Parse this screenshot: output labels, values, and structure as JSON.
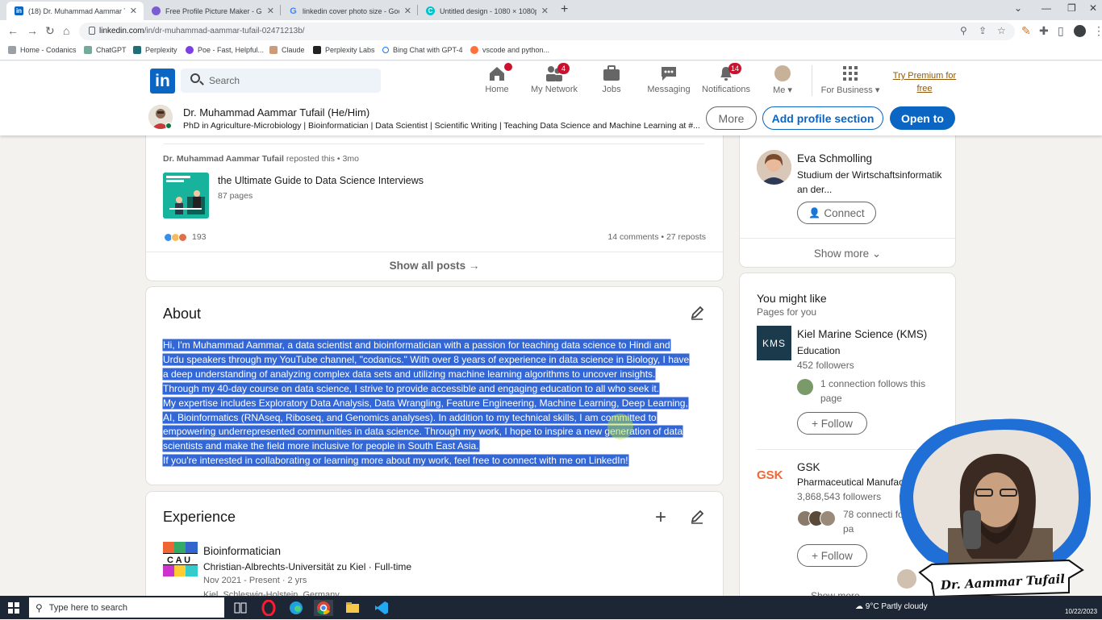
{
  "browser": {
    "tabs": [
      {
        "title": "(18) Dr. Muhammad Aammar Tu",
        "favicon": "linkedin-icon",
        "active": true
      },
      {
        "title": "Free Profile Picture Maker - Gen",
        "favicon": "profile-maker-icon"
      },
      {
        "title": "linkedin cover photo size - Goog",
        "favicon": "google-icon"
      },
      {
        "title": "Untitled design - 1080 × 1080px",
        "favicon": "canva-icon"
      }
    ],
    "url_host": "linkedin.com",
    "url_path": "/in/dr-muhammad-aammar-tufail-02471213b/",
    "bookmarks": [
      "Home - Codanics",
      "ChatGPT",
      "Perplexity",
      "Poe - Fast, Helpful...",
      "Claude",
      "Perplexity Labs",
      "Bing Chat with GPT-4",
      "vscode and python..."
    ]
  },
  "linkedin": {
    "search_placeholder": "Search",
    "nav": [
      {
        "label": "Home",
        "badge": ""
      },
      {
        "label": "My Network",
        "badge": "4"
      },
      {
        "label": "Jobs",
        "badge": ""
      },
      {
        "label": "Messaging",
        "badge": ""
      },
      {
        "label": "Notifications",
        "badge": "14"
      },
      {
        "label": "Me ▾",
        "badge": ""
      },
      {
        "label": "For Business ▾",
        "badge": ""
      }
    ],
    "premium_line1": "Try Premium for",
    "premium_line2": "free"
  },
  "profile_bar": {
    "name": "Dr. Muhammad Aammar Tufail (He/Him)",
    "headline": "PhD in Agriculture-Microbiology | Bioinformatician | Data Scientist | Scientific Writing | Teaching Data Science and Machine Learning at #...",
    "more": "More",
    "add_section": "Add profile section",
    "open_to": "Open to"
  },
  "posts": {
    "repost_author": "Dr. Muhammad Aammar Tufail",
    "repost_meta": " reposted this • 3mo",
    "doc_title": "the Ultimate Guide to Data Science Interviews",
    "doc_pages": "87 pages",
    "reactions": "193",
    "engagement": "14 comments • 27 reposts",
    "show_all": "Show all posts →"
  },
  "about": {
    "title": "About",
    "lines": [
      "Hi, I'm Muhammad Aammar, a data scientist and bioinformatician with a passion for teaching data science to Hindi and",
      "Urdu speakers through my YouTube channel, \"codanics.\" With over 8 years of experience in data science in Biology, I have",
      "a deep understanding of analyzing complex data sets and utilizing machine learning algorithms to uncover insights.",
      "Through my 40-day course on data science, I strive to provide accessible and engaging education to all who seek it.",
      "My expertise includes Exploratory Data Analysis, Data Wrangling, Feature Engineering, Machine Learning, Deep Learning,",
      "AI, Bioinformatics (RNAseq, Riboseq, and Genomics analyses). In addition to my technical skills, I am committed to",
      "empowering underrepresented communities in data science. Through my work, I hope to inspire a new generation of data",
      "scientists and make the field more inclusive for people in South East Asia.",
      "If you're interested in collaborating or learning more about my work, feel free to connect with me on LinkedIn!"
    ]
  },
  "experience": {
    "title": "Experience",
    "role": "Bioinformatician",
    "org": "Christian-Albrechts-Universität zu Kiel · Full-time",
    "dates": "Nov 2021 - Present · 2 yrs",
    "location": "Kiel, Schleswig-Holstein, Germany"
  },
  "people": {
    "name": "Eva Schmolling",
    "subtitle": "Studium der Wirtschaftsinformatik an der...",
    "connect": "Connect",
    "show_more": "Show more"
  },
  "you_might_like": {
    "title": "You might like",
    "subtitle": "Pages for you",
    "pages": [
      {
        "logo": "KMS",
        "name": "Kiel Marine Science (KMS)",
        "category": "Education",
        "followers": "452 followers",
        "connections": "1 connection follows this page",
        "follow": "+ Follow"
      },
      {
        "logo": "GSK",
        "name": "GSK",
        "category": "Pharmaceutical Manufac",
        "followers": "3,868,543 followers",
        "connections": "78 connecti follow this pa",
        "follow": "+ Follow"
      }
    ],
    "show_more": "Show more"
  },
  "webcam": {
    "caption": "Dr. Aammar Tufail"
  },
  "taskbar": {
    "search_placeholder": "Type here to search",
    "weather": "9°C  Partly cloudy",
    "date": "10/22/2023"
  },
  "colors": {
    "linkedin_blue": "#0a66c2",
    "selection": "#3367d6",
    "badge_red": "#cb112d",
    "gsk_orange": "#f36633"
  }
}
